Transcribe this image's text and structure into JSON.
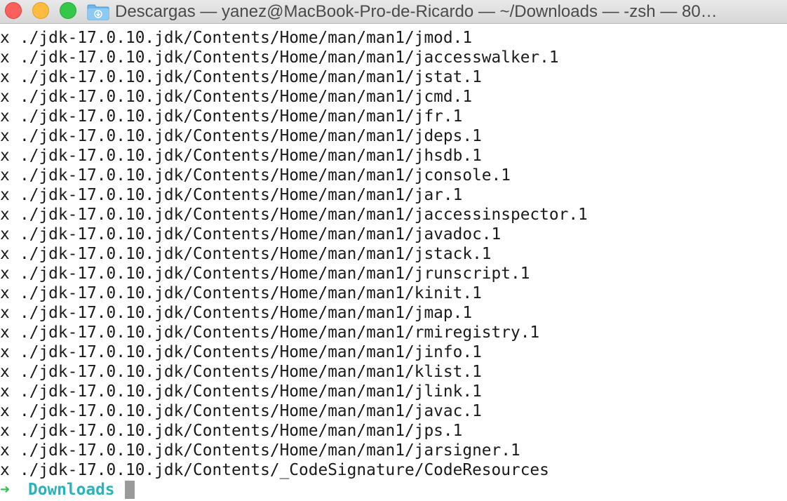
{
  "window": {
    "title": "Descargas — yanez@MacBook-Pro-de-Ricardo — ~/Downloads — -zsh — 80…"
  },
  "terminal": {
    "lines": [
      {
        "flag": "x",
        "path": "./jdk-17.0.10.jdk/Contents/Home/man/man1/jmod.1"
      },
      {
        "flag": "x",
        "path": "./jdk-17.0.10.jdk/Contents/Home/man/man1/jaccesswalker.1"
      },
      {
        "flag": "x",
        "path": "./jdk-17.0.10.jdk/Contents/Home/man/man1/jstat.1"
      },
      {
        "flag": "x",
        "path": "./jdk-17.0.10.jdk/Contents/Home/man/man1/jcmd.1"
      },
      {
        "flag": "x",
        "path": "./jdk-17.0.10.jdk/Contents/Home/man/man1/jfr.1"
      },
      {
        "flag": "x",
        "path": "./jdk-17.0.10.jdk/Contents/Home/man/man1/jdeps.1"
      },
      {
        "flag": "x",
        "path": "./jdk-17.0.10.jdk/Contents/Home/man/man1/jhsdb.1"
      },
      {
        "flag": "x",
        "path": "./jdk-17.0.10.jdk/Contents/Home/man/man1/jconsole.1"
      },
      {
        "flag": "x",
        "path": "./jdk-17.0.10.jdk/Contents/Home/man/man1/jar.1"
      },
      {
        "flag": "x",
        "path": "./jdk-17.0.10.jdk/Contents/Home/man/man1/jaccessinspector.1"
      },
      {
        "flag": "x",
        "path": "./jdk-17.0.10.jdk/Contents/Home/man/man1/javadoc.1"
      },
      {
        "flag": "x",
        "path": "./jdk-17.0.10.jdk/Contents/Home/man/man1/jstack.1"
      },
      {
        "flag": "x",
        "path": "./jdk-17.0.10.jdk/Contents/Home/man/man1/jrunscript.1"
      },
      {
        "flag": "x",
        "path": "./jdk-17.0.10.jdk/Contents/Home/man/man1/kinit.1"
      },
      {
        "flag": "x",
        "path": "./jdk-17.0.10.jdk/Contents/Home/man/man1/jmap.1"
      },
      {
        "flag": "x",
        "path": "./jdk-17.0.10.jdk/Contents/Home/man/man1/rmiregistry.1"
      },
      {
        "flag": "x",
        "path": "./jdk-17.0.10.jdk/Contents/Home/man/man1/jinfo.1"
      },
      {
        "flag": "x",
        "path": "./jdk-17.0.10.jdk/Contents/Home/man/man1/klist.1"
      },
      {
        "flag": "x",
        "path": "./jdk-17.0.10.jdk/Contents/Home/man/man1/jlink.1"
      },
      {
        "flag": "x",
        "path": "./jdk-17.0.10.jdk/Contents/Home/man/man1/javac.1"
      },
      {
        "flag": "x",
        "path": "./jdk-17.0.10.jdk/Contents/Home/man/man1/jps.1"
      },
      {
        "flag": "x",
        "path": "./jdk-17.0.10.jdk/Contents/Home/man/man1/jarsigner.1"
      },
      {
        "flag": "x",
        "path": "./jdk-17.0.10.jdk/Contents/_CodeSignature/CodeResources"
      }
    ],
    "prompt": {
      "arrow": "➜",
      "directory": "Downloads"
    }
  },
  "colors": {
    "close": "#fc605c",
    "minimize": "#fdbc40",
    "maximize": "#34c84a",
    "prompt_arrow": "#30c24b",
    "prompt_dir": "#2ab3b8",
    "cursor": "#9a9a9a"
  },
  "icons": {
    "title_icon": "downloads-folder-icon"
  }
}
